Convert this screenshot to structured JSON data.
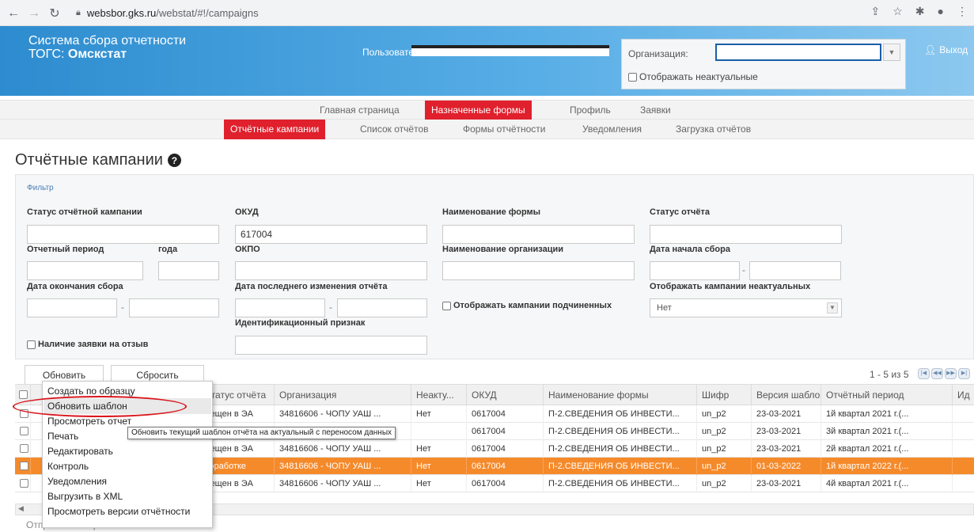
{
  "browser": {
    "url_host": "websbor.gks.ru",
    "url_path": "/webstat/#!/campaigns"
  },
  "header": {
    "system_title_line1": "Система сбора отчетности",
    "system_title_prefix": "ТОГС: ",
    "system_title_region": "Омскстат",
    "user_label": "Пользователь:",
    "org_label": "Организация:",
    "show_inactive_label": "Отображать неактуальные",
    "logout_label": "Выход"
  },
  "nav_main": [
    {
      "label": "Главная страница",
      "active": false
    },
    {
      "label": "Назначенные формы",
      "active": true
    },
    {
      "label": "Профиль",
      "active": false
    },
    {
      "label": "Заявки",
      "active": false
    }
  ],
  "nav_sub": [
    {
      "label": "Отчётные кампании",
      "active": true
    },
    {
      "label": "Список отчётов",
      "active": false
    },
    {
      "label": "Формы отчётности",
      "active": false
    },
    {
      "label": "Уведомления",
      "active": false
    },
    {
      "label": "Загрузка отчётов",
      "active": false
    }
  ],
  "page": {
    "title": "Отчётные кампании"
  },
  "filter": {
    "link": "Фильтр",
    "campaign_status_label": "Статус отчётной кампании",
    "campaign_status_value": "",
    "okud_label": "ОКУД",
    "okud_value": "617004",
    "form_name_label": "Наименование формы",
    "form_name_value": "",
    "report_status_label": "Статус отчёта",
    "report_status_value": "",
    "period_label": "Отчетный период",
    "period_value": "",
    "year_label": "года",
    "year_value": "",
    "okpo_label": "ОКПО",
    "okpo_value": "",
    "org_name_label": "Наименование организации",
    "org_name_value": "",
    "start_date_label": "Дата начала сбора",
    "end_date_label": "Дата окончания сбора",
    "last_change_label": "Дата последнего изменения отчёта",
    "show_sub_label": "Отображать кампании подчиненных",
    "show_inactive_campaigns_label": "Отображать кампании неактуальных",
    "show_inactive_campaigns_value": "Нет",
    "ident_label": "Идентификационный признак",
    "ident_value": "",
    "revocation_label": "Наличие заявки на отзыв",
    "dash": "-"
  },
  "toolbar": {
    "refresh_label": "Обновить",
    "reset_label": "Сбросить",
    "pager_text": "1 - 5 из 5"
  },
  "grid": {
    "columns": [
      "",
      "",
      "Статус отчёта",
      "Организация",
      "Неакту...",
      "ОКУД",
      "Наименование формы",
      "Шифр",
      "Версия шабло...",
      "Отчётный период",
      "Ид"
    ],
    "rows": [
      {
        "status": "мещен в ЭА",
        "org": "34816606 - ЧОПУ УАШ ...",
        "inactive": "Нет",
        "okud": "0617004",
        "form": "П-2.СВЕДЕНИЯ ОБ ИНВЕСТИ...",
        "code": "un_p2",
        "version": "23-03-2021",
        "period": "1й квартал 2021 г.(...",
        "highlight": false
      },
      {
        "status": "",
        "org": "",
        "inactive": "",
        "okud": "0617004",
        "form": "П-2.СВЕДЕНИЯ ОБ ИНВЕСТИ...",
        "code": "un_p2",
        "version": "23-03-2021",
        "period": "3й квартал 2021 г.(...",
        "highlight": false
      },
      {
        "status": "мещен в ЭА",
        "org": "34816606 - ЧОПУ УАШ ...",
        "inactive": "Нет",
        "okud": "0617004",
        "form": "П-2.СВЕДЕНИЯ ОБ ИНВЕСТИ...",
        "code": "un_p2",
        "version": "23-03-2021",
        "period": "2й квартал 2021 г.(...",
        "highlight": false
      },
      {
        "status": "доработке",
        "org": "34816606 - ЧОПУ УАШ ...",
        "inactive": "Нет",
        "okud": "0617004",
        "form": "П-2.СВЕДЕНИЯ ОБ ИНВЕСТИ...",
        "code": "un_p2",
        "version": "01-03-2022",
        "period": "1й квартал 2022 г.(...",
        "highlight": true
      },
      {
        "status": "мещен в ЭА",
        "org": "34816606 - ЧОПУ УАШ ...",
        "inactive": "Нет",
        "okud": "0617004",
        "form": "П-2.СВЕДЕНИЯ ОБ ИНВЕСТИ...",
        "code": "un_p2",
        "version": "23-03-2021",
        "period": "4й квартал 2021 г.(...",
        "highlight": false
      }
    ]
  },
  "context_menu": {
    "items": [
      "Создать по образцу",
      "Обновить шаблон",
      "Просмотреть отчет",
      "Печать",
      "Редактировать",
      "Контроль",
      "Уведомления",
      "Выгрузить в XML",
      "Просмотреть версии отчётности"
    ],
    "tooltip": "Обновить текущий шаблон отчёта на актуальный с переносом данных"
  },
  "bottom": {
    "send_selected": "Отправить выбранные отчеты"
  },
  "colors": {
    "accent_red": "#e0202d",
    "header_blue": "#2d8ccf",
    "highlight_orange": "#f58a2b"
  }
}
